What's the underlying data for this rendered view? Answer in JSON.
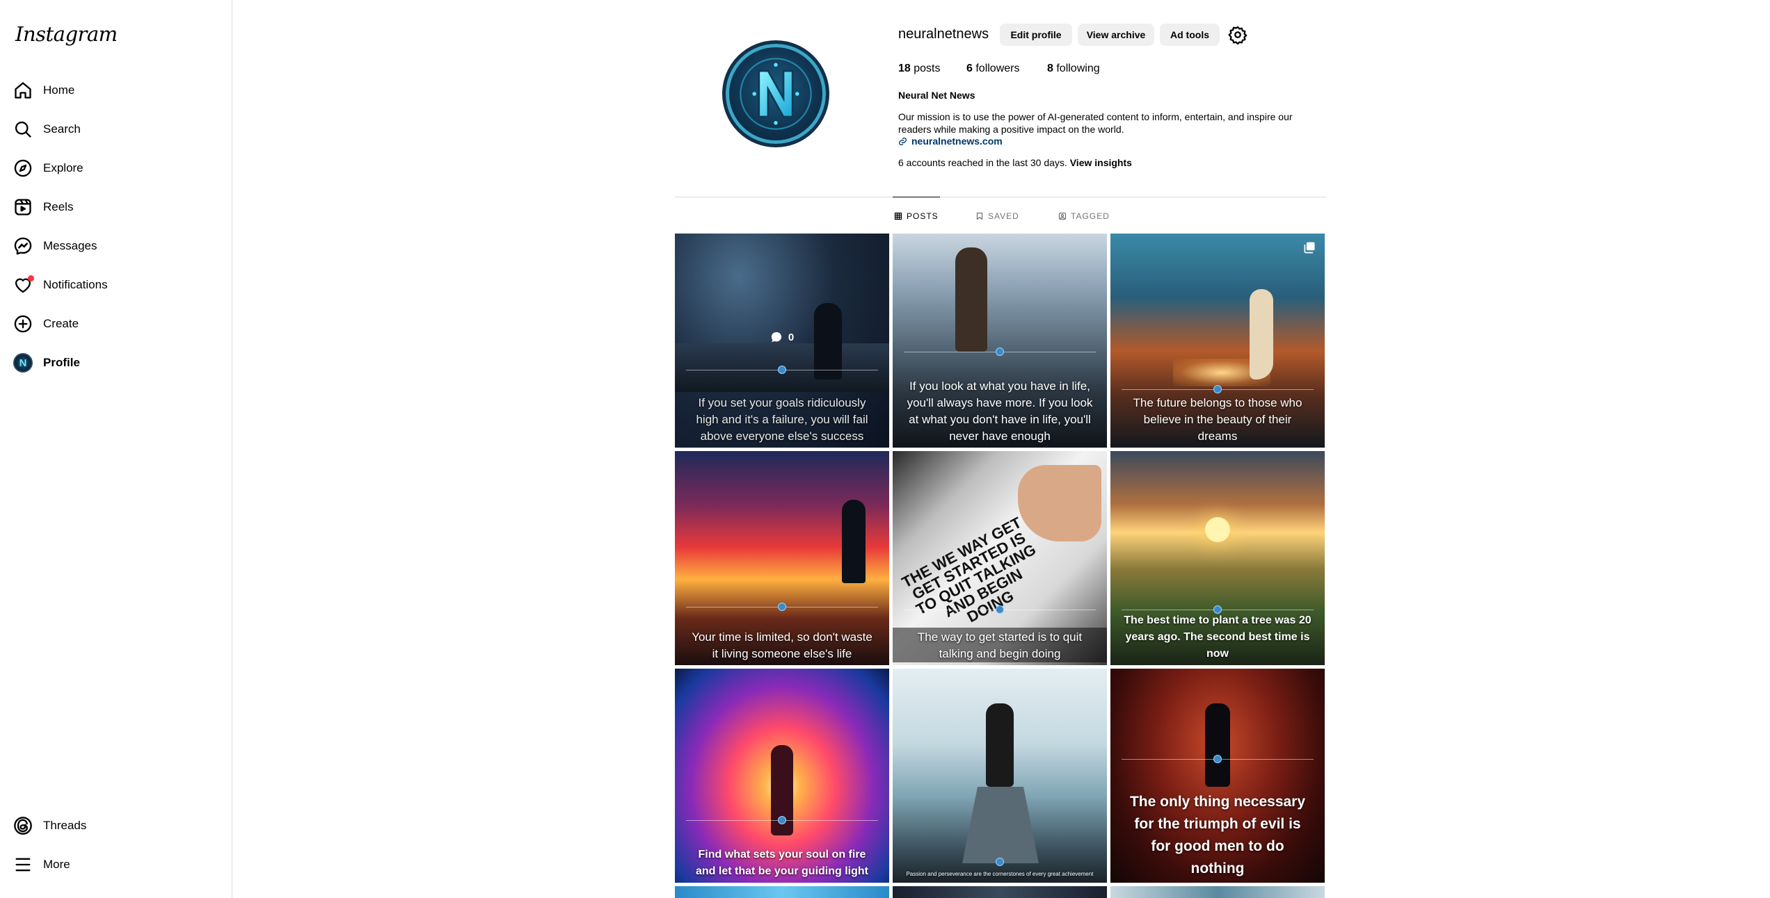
{
  "app": {
    "logo_text": "Instagram"
  },
  "sidebar": {
    "items": [
      {
        "label": "Home",
        "icon": "home-icon"
      },
      {
        "label": "Search",
        "icon": "search-icon"
      },
      {
        "label": "Explore",
        "icon": "compass-icon"
      },
      {
        "label": "Reels",
        "icon": "reels-icon"
      },
      {
        "label": "Messages",
        "icon": "messenger-icon"
      },
      {
        "label": "Notifications",
        "icon": "heart-icon"
      },
      {
        "label": "Create",
        "icon": "plus-square-icon"
      },
      {
        "label": "Profile",
        "icon": "avatar"
      }
    ],
    "bottom_items": [
      {
        "label": "Threads",
        "icon": "threads-icon"
      },
      {
        "label": "More",
        "icon": "menu-icon"
      }
    ]
  },
  "profile": {
    "username": "neuralnetnews",
    "buttons": {
      "edit": "Edit profile",
      "archive": "View archive",
      "ad_tools": "Ad tools"
    },
    "stats": {
      "posts_count": "18",
      "posts_label": " posts",
      "followers_count": "6",
      "followers_label": " followers",
      "following_count": "8",
      "following_label": " following"
    },
    "full_name": "Neural Net News",
    "bio": "Our mission is to use the power of AI-generated content to inform, entertain, and inspire our readers while making a positive impact on the world.",
    "website": "neuralnetnews.com",
    "insights_text": "6 accounts reached in the last 30 days. ",
    "insights_link": "View insights"
  },
  "tabs": [
    {
      "label": "POSTS",
      "active": true
    },
    {
      "label": "SAVED",
      "active": false
    },
    {
      "label": "TAGGED",
      "active": false
    }
  ],
  "posts": [
    {
      "caption": "If you set your goals ridiculously high and it's a failure, you will fail above everyone else's success",
      "comments": "0"
    },
    {
      "caption": "If you look at what you have in life, you'll always have more. If you look at what you don't have in life, you'll never have enough"
    },
    {
      "caption": "The future belongs to those who believe in the beauty of their dreams"
    },
    {
      "caption": "Your time is limited, so don't waste it living someone else's life"
    },
    {
      "caption": "The way to get started is to quit talking and begin doing",
      "art_text": "THE WE WAY GET GET STARTED IS TO QUIT TALKING AND BEGIN DOING"
    },
    {
      "caption": "The best time to plant a tree was 20 years ago. The second best time is now"
    },
    {
      "caption": "Find what sets your soul on fire and let that be your guiding light"
    },
    {
      "caption": "Passion and perseverance are the cornerstones of every great achievement"
    },
    {
      "caption": "The only thing necessary for the triumph of evil is for good men to do nothing"
    }
  ],
  "colors": {
    "link": "#00376b",
    "button_bg": "#efefef",
    "border": "#dbdbdb",
    "muted": "#737373",
    "notification_dot": "#ff3040"
  }
}
